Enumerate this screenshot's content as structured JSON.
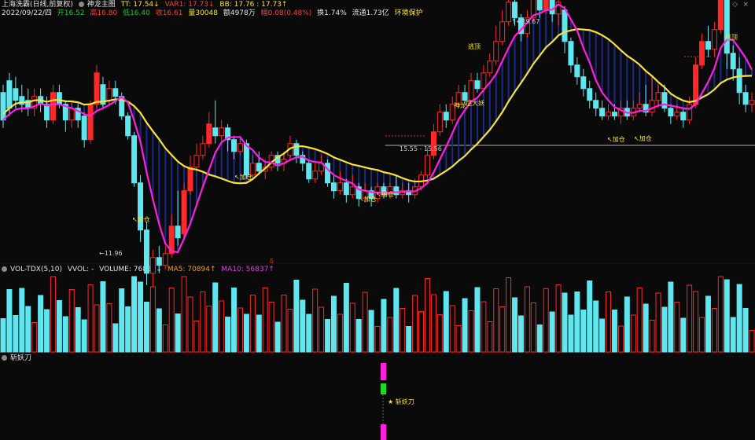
{
  "header": {
    "title": "上海洗霸(日线,前复权)",
    "indicator_name": "神龙主图",
    "tt": "TT: 17.54↓",
    "var1": "VAR1: 17.73↓",
    "bb": "BB: 17.76 : 17.73↑",
    "date": "2022/09/22/四",
    "open": "开16.52",
    "high": "高16.80",
    "low": "低16.40",
    "close": "收16.61",
    "volume": "量30048",
    "amount": "额4978万",
    "change": "幅0.08(0.48%)",
    "turnover": "换1.74%",
    "float_cap": "流通1.73亿",
    "protect": "环境保护",
    "window_controls": [
      "◇",
      "×"
    ]
  },
  "price_chart": {
    "annotations": {
      "high_label": "19.67",
      "low_label": "11.96",
      "price_line_label": "15.55 - 15.56",
      "escape_top": "逃顶",
      "shenlong": "神龙",
      "zhengdayao": "症大妖",
      "add_position": "加仓"
    },
    "colors": {
      "up": "#ff2828",
      "down": "#5fe6ef",
      "ma_yellow": "#f6e33a",
      "ma_green": "#22d822",
      "ma_magenta": "#ff1fe0",
      "fill": "#1a2a8a"
    }
  },
  "volume_panel": {
    "name": "VOL-TDX(5,10)",
    "vvol": "VVOL: -",
    "volume": "VOLUME: 76850↓",
    "ma5": "MA5: 70894↑",
    "ma10": "MA10: 56837↑"
  },
  "indicator_panel": {
    "name": "斩妖刀",
    "signal_label": "★ 斩妖刀"
  }
}
